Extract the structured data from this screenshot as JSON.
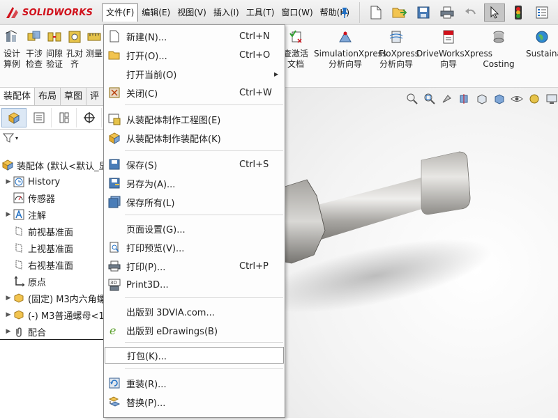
{
  "app": {
    "logo_text": "SOLIDWORKS"
  },
  "menubar": {
    "items": [
      "文件(F)",
      "编辑(E)",
      "视图(V)",
      "插入(I)",
      "工具(T)",
      "窗口(W)",
      "帮助(H)"
    ]
  },
  "ribbon": {
    "buttons": [
      {
        "label1": "设计",
        "label2": "算例"
      },
      {
        "label1": "干涉",
        "label2": "检查"
      },
      {
        "label1": "间隙",
        "label2": "验证"
      },
      {
        "label1": "孔对",
        "label2": "齐"
      },
      {
        "label1": "测量",
        "label2": ""
      },
      {
        "label1": "查激活",
        "label2": "文档"
      },
      {
        "label1": "SimulationXpress",
        "label2": "分析向导"
      },
      {
        "label1": "FloXpress",
        "label2": "分析向导"
      },
      {
        "label1": "DriveWorksXpress",
        "label2": "向导"
      },
      {
        "label1": "",
        "label2": "Costing"
      },
      {
        "label1": "Sustaina",
        "label2": ""
      }
    ],
    "tabs": [
      "装配体",
      "布局",
      "草图",
      "评"
    ]
  },
  "feature_tree": {
    "root": "装配体 (默认<默认_显",
    "items": [
      {
        "label": "History",
        "arrow": true
      },
      {
        "label": "传感器",
        "arrow": false
      },
      {
        "label": "注解",
        "arrow": true
      },
      {
        "label": "前视基准面",
        "arrow": false
      },
      {
        "label": "上视基准面",
        "arrow": false
      },
      {
        "label": "右视基准面",
        "arrow": false
      },
      {
        "label": "原点",
        "arrow": false
      },
      {
        "label": "(固定) M3内六角螺",
        "arrow": true
      },
      {
        "label": "(-) M3普通螺母<1",
        "arrow": true
      },
      {
        "label": "配合",
        "arrow": true
      }
    ]
  },
  "file_menu": {
    "items": [
      {
        "label": "新建(N)...",
        "shortcut": "Ctrl+N"
      },
      {
        "label": "打开(O)...",
        "shortcut": "Ctrl+O"
      },
      {
        "label": "打开当前(O)",
        "shortcut": ""
      },
      {
        "label": "关闭(C)",
        "shortcut": "Ctrl+W"
      },
      {
        "label": "从装配体制作工程图(E)",
        "shortcut": ""
      },
      {
        "label": "从装配体制作装配体(K)",
        "shortcut": ""
      },
      {
        "label": "保存(S)",
        "shortcut": "Ctrl+S"
      },
      {
        "label": "另存为(A)...",
        "shortcut": ""
      },
      {
        "label": "保存所有(L)",
        "shortcut": ""
      },
      {
        "label": "页面设置(G)...",
        "shortcut": ""
      },
      {
        "label": "打印预览(V)...",
        "shortcut": ""
      },
      {
        "label": "打印(P)...",
        "shortcut": "Ctrl+P"
      },
      {
        "label": "Print3D...",
        "shortcut": ""
      },
      {
        "label": "出版到 3DVIA.com...",
        "shortcut": ""
      },
      {
        "label": "出版到 eDrawings(B)",
        "shortcut": ""
      },
      {
        "label": "打包(K)...",
        "shortcut": ""
      },
      {
        "label": "重装(R)...",
        "shortcut": ""
      },
      {
        "label": "替换(P)...",
        "shortcut": ""
      }
    ]
  },
  "colors": {
    "brand_red": "#d0111b",
    "accent_blue": "#1f6fc4"
  }
}
